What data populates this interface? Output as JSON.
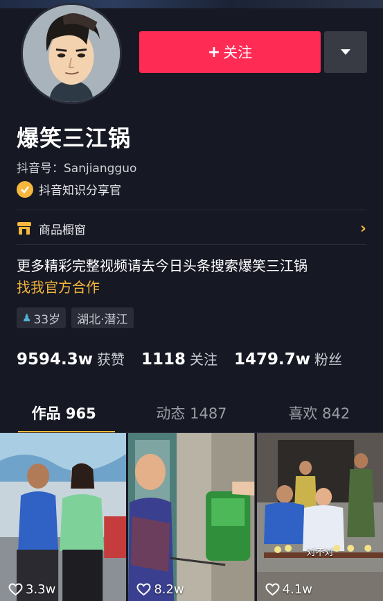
{
  "profile": {
    "name": "爆笑三江锅",
    "douyin_id": "抖音号：Sanjiangguo",
    "certification": "抖音知识分享官"
  },
  "actions": {
    "follow_label": "关注",
    "follow_prefix": "+",
    "more_icon": "triangle-down-icon"
  },
  "shop": {
    "label": "商品橱窗"
  },
  "bio": {
    "text": "更多精彩完整视频请去今日头条搜索爆笑三江锅",
    "link": "找我官方合作"
  },
  "tags": [
    {
      "label": "33岁",
      "icon": "person-icon"
    },
    {
      "label": "湖北·潜江"
    }
  ],
  "stats": [
    {
      "value": "9594.3w",
      "label": "获赞"
    },
    {
      "value": "1118",
      "label": "关注"
    },
    {
      "value": "1479.7w",
      "label": "粉丝"
    }
  ],
  "tabs": [
    {
      "label": "作品 965",
      "active": true
    },
    {
      "label": "动态 1487",
      "active": false
    },
    {
      "label": "喜欢 842",
      "active": false
    }
  ],
  "videos": [
    {
      "likes": "3.3w"
    },
    {
      "likes": "8.2w"
    },
    {
      "likes": "4.1w",
      "subtitle": "对不对"
    }
  ],
  "colors": {
    "background": "#161823",
    "follow": "#fe2c55",
    "accent": "#f6b73c"
  }
}
